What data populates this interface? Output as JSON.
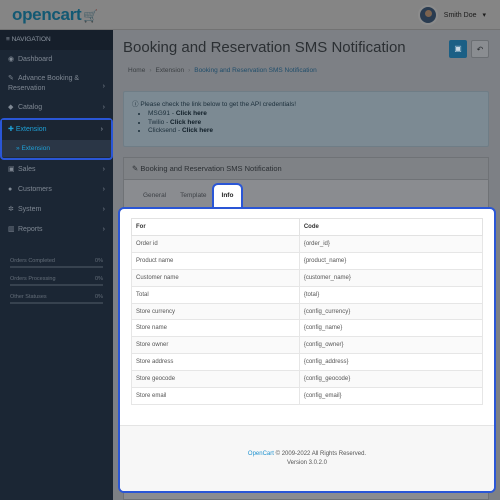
{
  "header": {
    "logo_text": "opencart",
    "logo_icon": "cart-icon",
    "user_name": "Smith Doe"
  },
  "sidebar": {
    "nav_label": "≡ NAVIGATION",
    "items": [
      {
        "icon": "dashboard-icon",
        "glyph": "◉",
        "label": "Dashboard",
        "chevron": ""
      },
      {
        "icon": "booking-icon",
        "glyph": "✎",
        "label": "Advance Booking & Reservation",
        "chevron": "›"
      },
      {
        "icon": "tag-icon",
        "glyph": "◆",
        "label": "Catalog",
        "chevron": "›"
      },
      {
        "icon": "puzzle-icon",
        "glyph": "✚",
        "label": "Extension",
        "chevron": "›",
        "active": true
      },
      {
        "icon": "cart-icon",
        "glyph": "▣",
        "label": "Sales",
        "chevron": "›"
      },
      {
        "icon": "user-icon",
        "glyph": "●",
        "label": "Customers",
        "chevron": "›"
      },
      {
        "icon": "cog-icon",
        "glyph": "✲",
        "label": "System",
        "chevron": "›"
      },
      {
        "icon": "chart-icon",
        "glyph": "▥",
        "label": "Reports",
        "chevron": "›"
      }
    ],
    "subitem": {
      "glyph": "»",
      "label": "Extension"
    },
    "stats": [
      {
        "label": "Orders Completed",
        "value": "0%"
      },
      {
        "label": "Orders Processing",
        "value": "0%"
      },
      {
        "label": "Other Statuses",
        "value": "0%"
      }
    ]
  },
  "main": {
    "title": "Booking and Reservation SMS Notification",
    "save_glyph": "▣",
    "back_glyph": "↶",
    "breadcrumb": [
      "Home",
      "Extension",
      "Booking and Reservation SMS Notification"
    ],
    "alert": {
      "text": "Please check the link below to get the API credentials!",
      "links": [
        {
          "name": "MSG91",
          "action": "Click here"
        },
        {
          "name": "Twilio",
          "action": "Click here"
        },
        {
          "name": "Clicksend",
          "action": "Click here"
        }
      ]
    },
    "panel_title": "Booking and Reservation SMS Notification",
    "tabs": [
      "General",
      "Template",
      "Info"
    ],
    "table": {
      "headers": [
        "For",
        "Code"
      ],
      "rows": [
        [
          "Order id",
          "{order_id}"
        ],
        [
          "Product name",
          "{product_name}"
        ],
        [
          "Customer name",
          "{customer_name}"
        ],
        [
          "Total",
          "{total}"
        ],
        [
          "Store currency",
          "{config_currency}"
        ],
        [
          "Store name",
          "{config_name}"
        ],
        [
          "Store owner",
          "{config_owner}"
        ],
        [
          "Store address",
          "{config_address}"
        ],
        [
          "Store geocode",
          "{config_geocode}"
        ],
        [
          "Store email",
          "{config_email}"
        ]
      ]
    },
    "footer": {
      "link": "OpenCart",
      "copyright": " © 2009-2022 All Rights Reserved.",
      "version": "Version 3.0.2.0"
    }
  }
}
